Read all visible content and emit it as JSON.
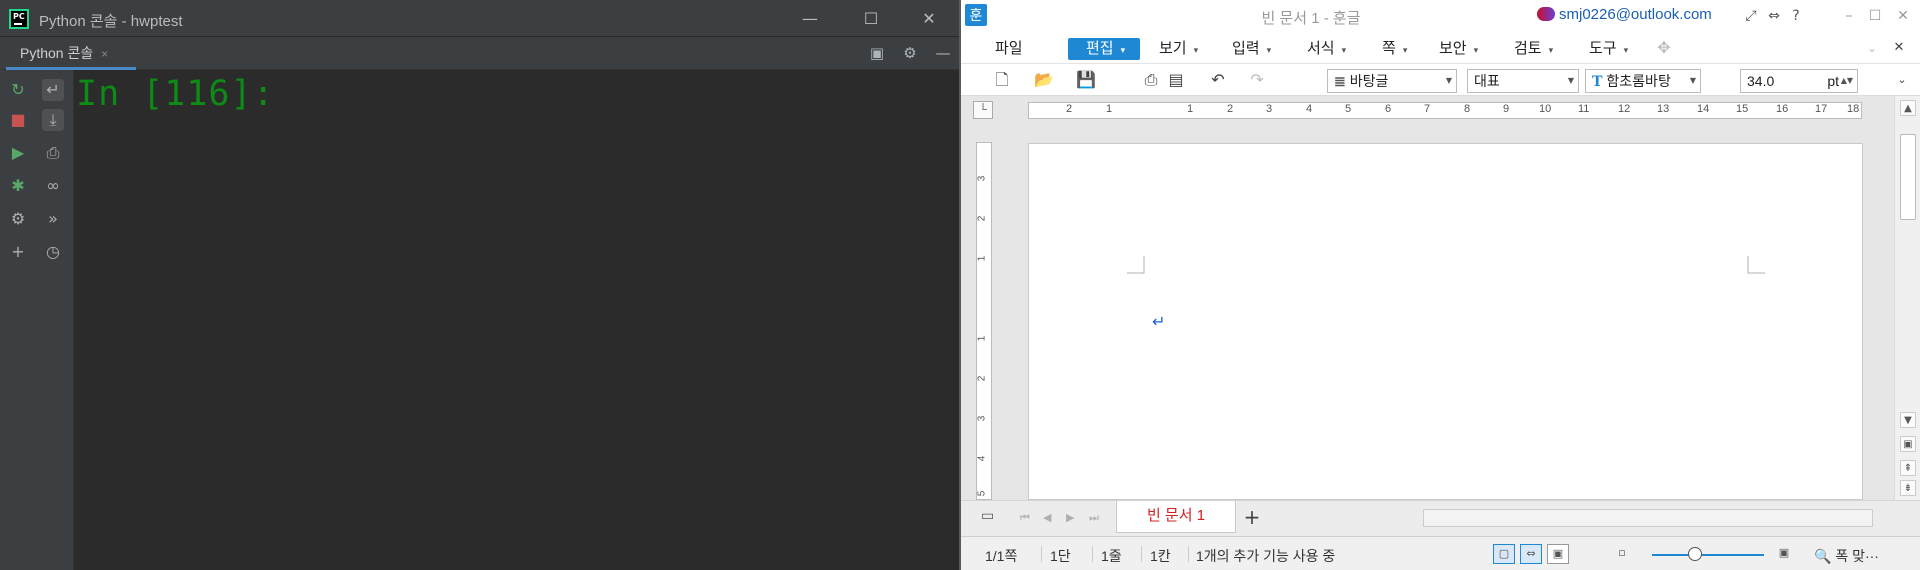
{
  "pycharm": {
    "window_title": "Python 콘솔 - hwptest",
    "tab_label": "Python 콘솔",
    "tab_close": "×",
    "prompt": "In [116]:",
    "window_buttons": {
      "minimize": "—",
      "maximize": "☐",
      "close": "✕"
    },
    "accent": "#21d789",
    "prompt_color": "#0e8a16"
  },
  "hangul": {
    "window_title": "빈 문서 1 - 훈글",
    "logo": "훈",
    "account": "smj0226@outlook.com",
    "menus": [
      {
        "label": "파일",
        "dropdown": ""
      },
      {
        "label": "편집",
        "dropdown": "▾"
      },
      {
        "label": "보기",
        "dropdown": "▾"
      },
      {
        "label": "입력",
        "dropdown": "▾"
      },
      {
        "label": "서식",
        "dropdown": "▾"
      },
      {
        "label": "쪽",
        "dropdown": "▾"
      },
      {
        "label": "보안",
        "dropdown": "▾"
      },
      {
        "label": "검토",
        "dropdown": "▾"
      },
      {
        "label": "도구",
        "dropdown": "▾"
      }
    ],
    "toolbar": {
      "style_combo": "바탕글",
      "language_combo": "대표",
      "font_combo": "함초롬바탕",
      "font_icon": "T",
      "size_value": "34.0",
      "size_unit": "pt"
    },
    "ruler": {
      "h_numbers": [
        "2",
        "1",
        "",
        "1",
        "2",
        "3",
        "4",
        "5",
        "6",
        "7",
        "8",
        "9",
        "10",
        "11",
        "12",
        "13",
        "14",
        "15",
        "16",
        "17",
        "18"
      ],
      "v_numbers": [
        "3",
        "2",
        "1",
        "",
        "1",
        "2",
        "3",
        "4",
        "5"
      ]
    },
    "doc_tab": "빈 문서 1",
    "add_tab": "+",
    "status": {
      "page": "1/1쪽",
      "column": "1단",
      "line": "1줄",
      "char": "1칸",
      "extra": "1개의 추가 기능 사용 중",
      "zoom_label": "폭 맞···"
    },
    "accent": "#1e88d4"
  }
}
